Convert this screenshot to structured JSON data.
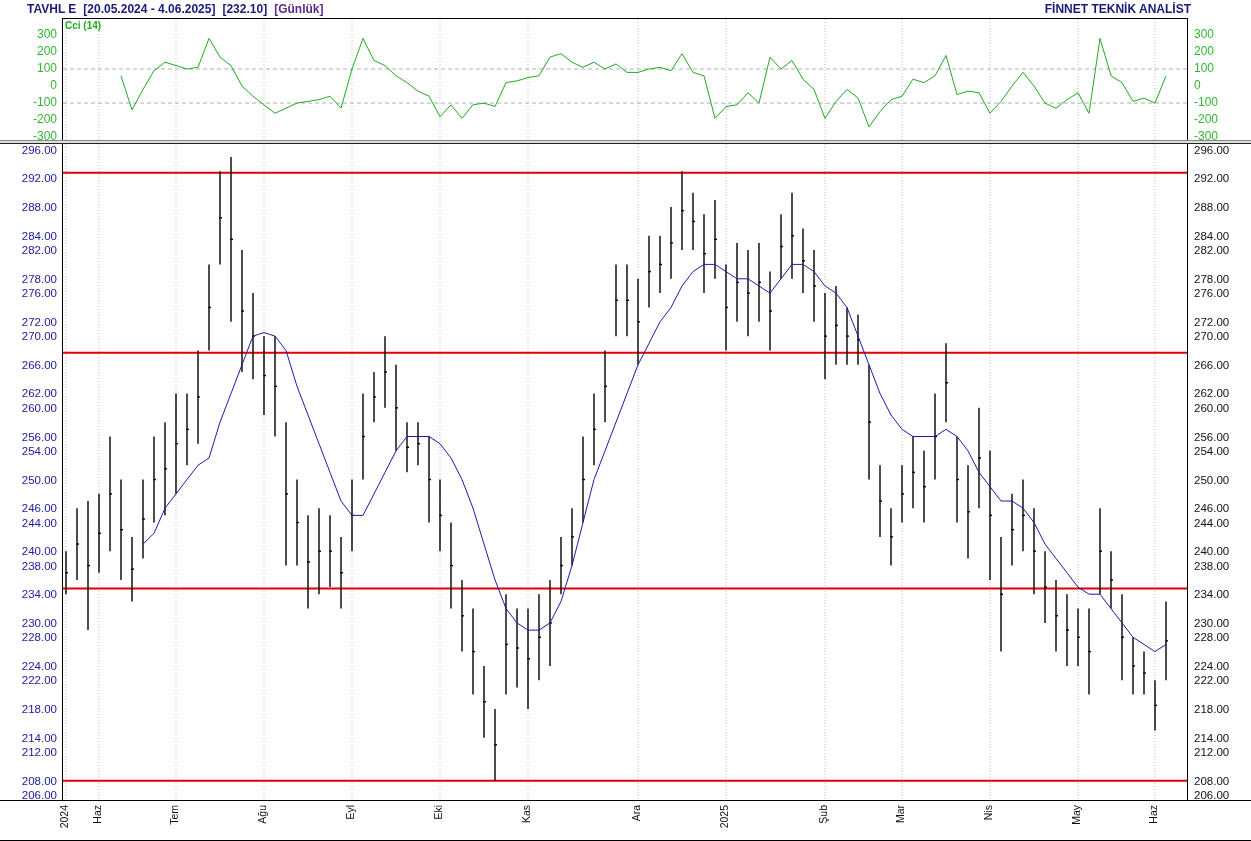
{
  "header": {
    "symbol": "TAVHL E",
    "range": "[20.05.2024 - 4.06.2025]",
    "last": "[232.10]",
    "period": "[Günlük]",
    "brand": "FİNNET TEKNİK ANALİST"
  },
  "cci_panel": {
    "chart_data": {
      "type": "line",
      "grid": true,
      "ylim": [
        -323,
        394
      ],
      "yticks": [
        300,
        200,
        100,
        0,
        -100,
        -200,
        -300
      ],
      "series": [
        {
          "name": "Cci (14)",
          "color": "#22aa22",
          "values": [
            null,
            null,
            null,
            null,
            null,
            60,
            -140,
            -20,
            90,
            140,
            120,
            100,
            110,
            280,
            170,
            120,
            0,
            -60,
            -110,
            -160,
            -130,
            -100,
            -90,
            -80,
            -60,
            -130,
            100,
            280,
            150,
            120,
            60,
            20,
            -30,
            -60,
            -180,
            -110,
            -190,
            -110,
            -100,
            -120,
            20,
            30,
            50,
            60,
            170,
            190,
            140,
            110,
            140,
            100,
            130,
            80,
            80,
            100,
            110,
            90,
            190,
            80,
            60,
            -190,
            -120,
            -110,
            -40,
            -100,
            170,
            100,
            150,
            40,
            -20,
            -190,
            -90,
            -20,
            -70,
            -240,
            -150,
            -80,
            -60,
            40,
            20,
            60,
            180,
            -50,
            -30,
            -40,
            -160,
            -90,
            0,
            80,
            0,
            -100,
            -130,
            -80,
            -40,
            -160,
            280,
            60,
            20,
            -90,
            -70,
            -100,
            60
          ]
        }
      ],
      "ref_lines": [
        {
          "axis": "y",
          "value": 100,
          "color": "#b0b0b0"
        },
        {
          "axis": "y",
          "value": -100,
          "color": "#b0b0b0"
        }
      ]
    },
    "right_axis": [
      "300",
      "200",
      "100",
      "0",
      "-100",
      "-200",
      "-300"
    ]
  },
  "price_panel": {
    "chart_data": {
      "type": "line",
      "grid": true,
      "ylim": [
        205.3,
        296.8
      ],
      "yticks": [
        {
          "value": 296,
          "label": "296.00"
        },
        {
          "value": 292,
          "label": "292.00"
        },
        {
          "value": 288,
          "label": "288.00"
        },
        {
          "value": 284,
          "label": "284.00"
        },
        {
          "value": 282,
          "label": "282.00"
        },
        {
          "value": 278,
          "label": "278.00"
        },
        {
          "value": 276,
          "label": "276.00"
        },
        {
          "value": 272,
          "label": "272.00"
        },
        {
          "value": 270,
          "label": "270.00"
        },
        {
          "value": 266,
          "label": "266.00"
        },
        {
          "value": 262,
          "label": "262.00"
        },
        {
          "value": 260,
          "label": "260.00"
        },
        {
          "value": 256,
          "label": "256.00"
        },
        {
          "value": 254,
          "label": "254.00"
        },
        {
          "value": 250,
          "label": "250.00"
        },
        {
          "value": 246,
          "label": "246.00"
        },
        {
          "value": 244,
          "label": "244.00"
        },
        {
          "value": 240,
          "label": "240.00"
        },
        {
          "value": 238,
          "label": "238.00"
        },
        {
          "value": 234,
          "label": "234.00"
        },
        {
          "value": 230,
          "label": "230.00"
        },
        {
          "value": 228,
          "label": "228.00"
        },
        {
          "value": 224,
          "label": "224.00"
        },
        {
          "value": 222,
          "label": "222.00"
        },
        {
          "value": 218,
          "label": "218.00"
        },
        {
          "value": 214,
          "label": "214.00"
        },
        {
          "value": 212,
          "label": "212.00"
        },
        {
          "value": 208,
          "label": "208.00"
        },
        {
          "value": 206,
          "label": "206.00"
        }
      ],
      "categories": [
        "2024",
        null,
        null,
        "Haz",
        null,
        null,
        null,
        null,
        null,
        null,
        "Tem",
        null,
        null,
        null,
        null,
        null,
        null,
        null,
        "Ağu",
        null,
        null,
        null,
        null,
        null,
        null,
        null,
        "Eyl",
        null,
        null,
        null,
        null,
        null,
        null,
        null,
        "Eki",
        null,
        null,
        null,
        null,
        null,
        null,
        null,
        "Kas",
        null,
        null,
        null,
        null,
        null,
        null,
        null,
        null,
        null,
        "Ara",
        null,
        null,
        null,
        null,
        null,
        null,
        null,
        "2025",
        null,
        null,
        null,
        null,
        null,
        null,
        null,
        null,
        "Şub",
        null,
        null,
        null,
        null,
        null,
        null,
        "Mar",
        null,
        null,
        null,
        null,
        null,
        null,
        null,
        "Nis",
        null,
        null,
        null,
        null,
        null,
        null,
        null,
        "May",
        null,
        null,
        null,
        null,
        null,
        null,
        "Haz",
        null
      ],
      "series": [
        {
          "type": "scatter",
          "color": "#000000",
          "values": [
            237,
            241,
            238,
            242.5,
            248,
            243,
            237.5,
            244.5,
            250,
            251.5,
            255,
            257,
            261.5,
            274,
            286.5,
            283.5,
            273.5,
            270,
            264.5,
            263,
            248,
            244,
            238.5,
            240,
            240,
            237,
            245,
            256,
            261.5,
            265,
            260,
            254.5,
            255,
            250,
            245,
            238,
            231,
            226,
            219,
            213,
            227,
            226.5,
            225,
            228,
            230,
            238,
            242,
            250,
            257,
            263,
            275,
            275,
            272,
            279,
            280,
            283,
            287.5,
            286,
            281.5,
            283.5,
            274,
            277.5,
            276,
            277.5,
            273.5,
            282.5,
            284,
            280.5,
            277,
            270,
            271.5,
            270,
            269.5,
            258,
            247,
            242,
            248,
            251,
            249,
            256,
            263.5,
            250,
            245.5,
            253,
            245,
            234,
            243,
            245,
            240,
            235,
            231,
            229,
            228,
            226,
            240,
            236,
            228,
            224,
            223,
            218.5,
            227.5
          ],
          "errors": [
            3,
            5,
            9,
            5.5,
            8,
            7,
            4.5,
            5.5,
            6,
            6.5,
            7,
            5,
            6.5,
            6,
            6.5,
            11.5,
            8.5,
            6,
            5.5,
            7,
            10,
            6,
            6.5,
            6,
            5,
            5,
            5,
            6,
            3.5,
            5,
            6,
            3.5,
            3,
            6,
            5,
            6,
            5,
            6,
            5,
            5,
            7,
            5.5,
            7,
            6,
            6,
            4,
            4,
            6,
            5,
            5,
            5,
            5,
            6,
            5,
            4,
            5,
            5.5,
            4,
            5.5,
            5.5,
            6,
            5.5,
            6,
            5.5,
            5.5,
            4.5,
            6,
            4.5,
            5,
            6,
            5.5,
            4,
            3.5,
            8,
            5,
            4,
            4,
            5,
            5,
            6,
            5.5,
            6,
            6.5,
            7,
            9,
            8,
            5,
            5,
            6,
            5,
            5,
            5,
            4,
            6,
            6,
            4,
            6,
            4,
            3,
            3.5,
            5.5
          ]
        },
        {
          "color": "#1c1ca8",
          "values": [
            null,
            null,
            null,
            null,
            null,
            null,
            null,
            241,
            242.5,
            246,
            248,
            250,
            252,
            253,
            258,
            262,
            266,
            270,
            270.5,
            270,
            268,
            263,
            259,
            255,
            251,
            247,
            245,
            245,
            248,
            251,
            254,
            256,
            256,
            256,
            255,
            253,
            250,
            246,
            241,
            236,
            232,
            230,
            229,
            229,
            230,
            233,
            238,
            244,
            250,
            254,
            258,
            262,
            266,
            269,
            272,
            274,
            277,
            279,
            280,
            280,
            279,
            278,
            278,
            277,
            276,
            278,
            280,
            280,
            279,
            277,
            276,
            274,
            270,
            266,
            262,
            259,
            257,
            256,
            256,
            256,
            257,
            256,
            254,
            251,
            249,
            247,
            247,
            246,
            244,
            241,
            239,
            237,
            235,
            234,
            234,
            232,
            230,
            228,
            227,
            226,
            227
          ]
        }
      ],
      "ref_lines": [
        {
          "axis": "y",
          "value": 292.8,
          "color": "#e00000"
        },
        {
          "axis": "y",
          "value": 267.7,
          "color": "#e00000"
        },
        {
          "axis": "y",
          "value": 234.8,
          "color": "#e00000"
        },
        {
          "axis": "y",
          "value": 208.0,
          "color": "#e00000"
        }
      ]
    },
    "right_axis": [
      "296.00",
      "292.00",
      "288.00",
      "284.00",
      "282.00",
      "278.00",
      "276.00",
      "272.00",
      "270.00",
      "266.00",
      "262.00",
      "260.00",
      "256.00",
      "254.00",
      "250.00",
      "246.00",
      "244.00",
      "240.00",
      "238.00",
      "234.00",
      "230.00",
      "228.00",
      "224.00",
      "222.00",
      "218.00",
      "214.00",
      "212.00",
      "208.00",
      "206.00"
    ]
  }
}
